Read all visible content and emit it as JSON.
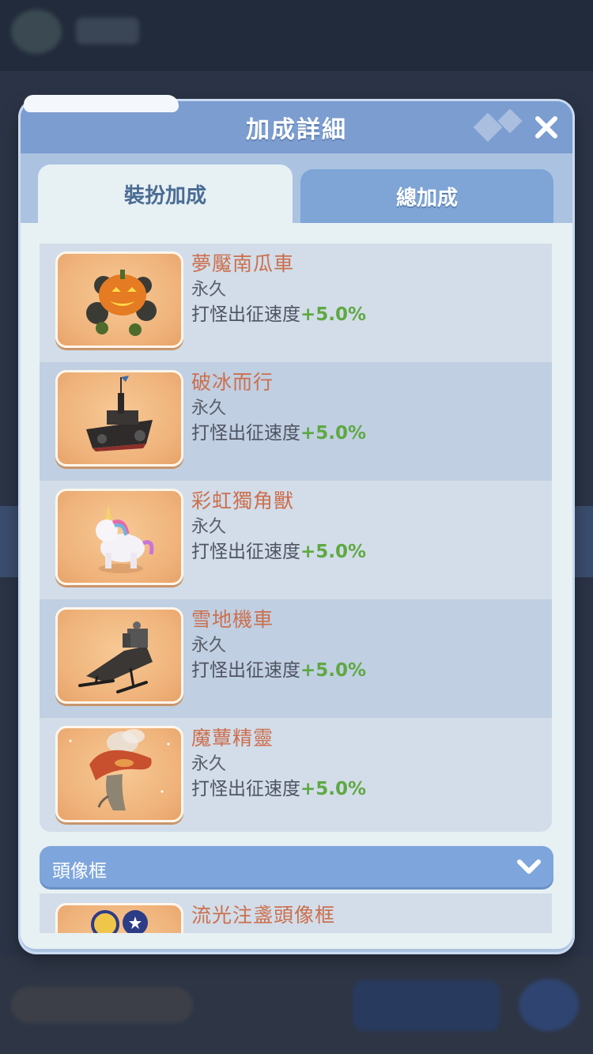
{
  "dialog": {
    "title": "加成詳細",
    "tabs": [
      {
        "label": "裝扮加成",
        "active": true
      },
      {
        "label": "總加成",
        "active": false
      }
    ]
  },
  "items": [
    {
      "name": "夢魘南瓜車",
      "duration": "永久",
      "bonus_label": "打怪出征速度",
      "bonus_value": "+5.0%",
      "icon": "pumpkin-carriage-icon"
    },
    {
      "name": "破冰而行",
      "duration": "永久",
      "bonus_label": "打怪出征速度",
      "bonus_value": "+5.0%",
      "icon": "icebreaker-ship-icon"
    },
    {
      "name": "彩虹獨角獸",
      "duration": "永久",
      "bonus_label": "打怪出征速度",
      "bonus_value": "+5.0%",
      "icon": "rainbow-unicorn-icon"
    },
    {
      "name": "雪地機車",
      "duration": "永久",
      "bonus_label": "打怪出征速度",
      "bonus_value": "+5.0%",
      "icon": "snowmobile-icon"
    },
    {
      "name": "魔蕈精靈",
      "duration": "永久",
      "bonus_label": "打怪出征速度",
      "bonus_value": "+5.0%",
      "icon": "mushroom-spirit-icon"
    }
  ],
  "section": {
    "label": "頭像框",
    "items": [
      {
        "name": "流光注盞頭像框",
        "icon": "avatar-frame-icon"
      }
    ]
  },
  "colors": {
    "header": "#7c9dd0",
    "item_name": "#cc6f4d",
    "bonus_value": "#5fa843",
    "panel": "#e7f0f3"
  }
}
